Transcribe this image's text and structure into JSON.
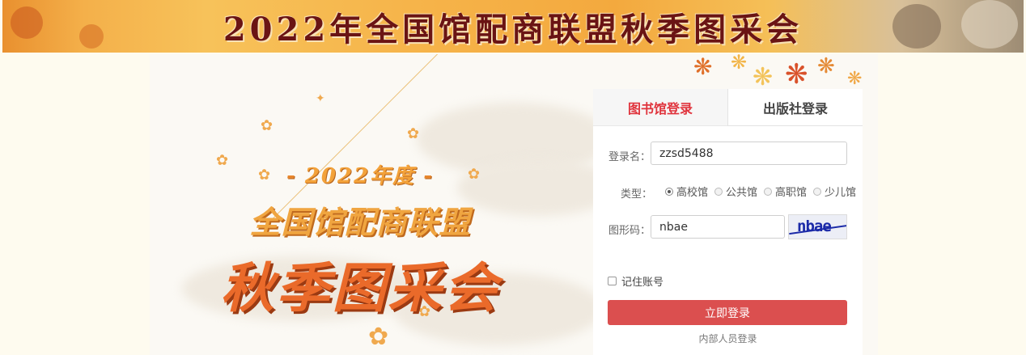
{
  "banner": {
    "title": "2022年全国馆配商联盟秋季图采会"
  },
  "promo": {
    "year_line": "2022年度",
    "dash": "-",
    "subtitle": "全国馆配商联盟",
    "main": "秋季图采会"
  },
  "login": {
    "tabs": [
      {
        "label": "图书馆登录",
        "active": true
      },
      {
        "label": "出版社登录",
        "active": false
      }
    ],
    "username": {
      "label": "登录名：",
      "value": "zzsd5488"
    },
    "type": {
      "label": "类型：",
      "options": [
        "高校馆",
        "公共馆",
        "高职馆",
        "少儿馆"
      ],
      "selected": "高校馆"
    },
    "captcha": {
      "label": "图形码：",
      "value": "nbae",
      "image_text": "nbae"
    },
    "remember_label": "记住账号",
    "submit_label": "立即登录",
    "internal_link": "内部人员登录"
  },
  "colors": {
    "accent": "#e0343d",
    "button": "#db4f4f",
    "banner_text": "#6a1414",
    "page_bg": "#fefbef"
  },
  "icons": [
    "maple-leaf-icon",
    "flower-icon",
    "radio-icon",
    "checkbox-icon"
  ]
}
